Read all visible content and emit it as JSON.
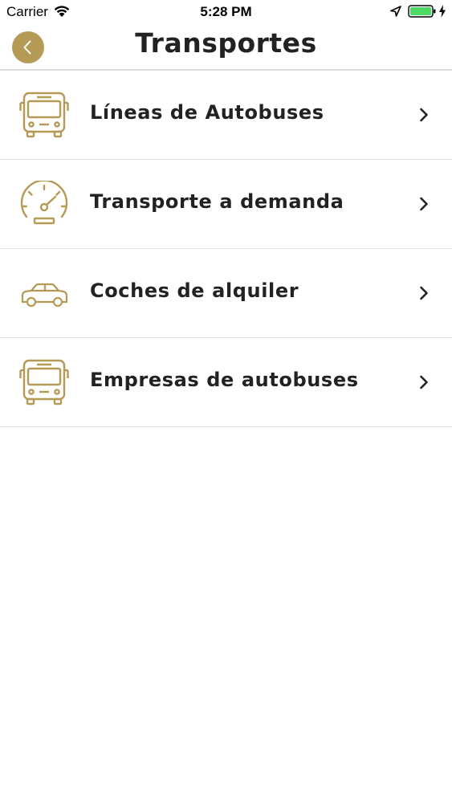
{
  "status_bar": {
    "carrier": "Carrier",
    "time": "5:28 PM",
    "battery_color": "#4cd964"
  },
  "nav": {
    "title": "Transportes",
    "back_icon": "chevron-left-icon",
    "accent_color": "#b59a56"
  },
  "menu": {
    "items": [
      {
        "label": "Líneas de Autobuses",
        "icon": "bus-icon"
      },
      {
        "label": "Transporte a demanda",
        "icon": "speedometer-icon"
      },
      {
        "label": "Coches de alquiler",
        "icon": "car-icon"
      },
      {
        "label": "Empresas de autobuses",
        "icon": "bus-icon"
      }
    ],
    "trailing_icon": "chevron-right-icon"
  }
}
